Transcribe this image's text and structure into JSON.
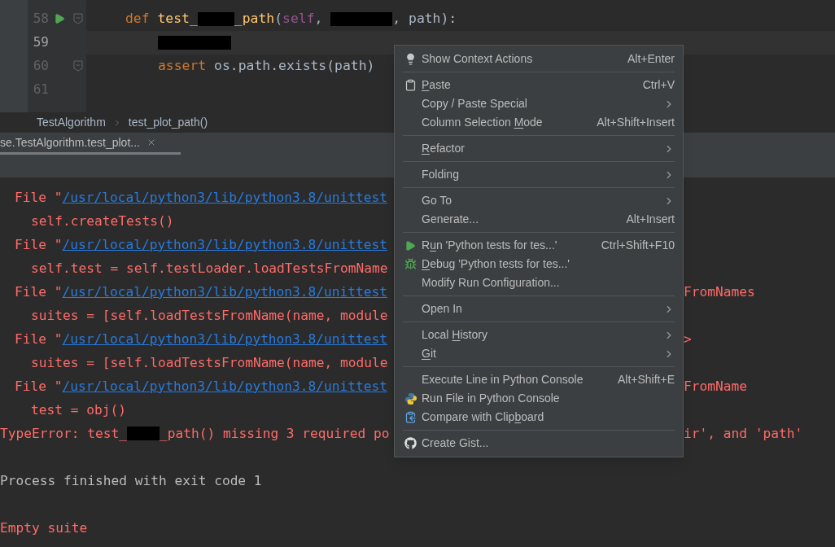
{
  "editor": {
    "lines": [
      {
        "number": "58",
        "current": false,
        "run_marker": true,
        "fold_marker": true,
        "segments": [
          {
            "kind": "keyword",
            "text": "def "
          },
          {
            "kind": "function",
            "text": "test_"
          },
          {
            "kind": "redacted"
          },
          {
            "kind": "function",
            "text": "_path"
          },
          {
            "kind": "plain",
            "text": "("
          },
          {
            "kind": "self",
            "text": "self"
          },
          {
            "kind": "plain",
            "text": ", "
          },
          {
            "kind": "redacted"
          },
          {
            "kind": "plain",
            "text": ", path):"
          }
        ],
        "children": [
          {
            "number": "59",
            "current": true,
            "run_marker": false,
            "fold_marker": false,
            "segments": [
              {
                "kind": "redacted"
              }
            ]
          },
          {
            "number": "60",
            "current": false,
            "run_marker": false,
            "fold_marker": true,
            "segments": [
              {
                "kind": "keyword",
                "text": "assert "
              },
              {
                "kind": "plain",
                "text": "os.path.exists(path)"
              }
            ]
          }
        ]
      },
      {
        "number": "61",
        "current": false,
        "run_marker": false,
        "fold_marker": false
      }
    ]
  },
  "breadcrumbs": [
    "TestAlgorithm",
    "test_plot_path()"
  ],
  "run_tab": {
    "label": "se.TestAlgorithm.test_plot...",
    "selected": true
  },
  "console": [
    {
      "kind": "file",
      "prefix": "File \"",
      "link": "/usr/local/python3/lib/python3.8/unittest",
      "children": [
        {
          "kind": "code",
          "text": "self.createTests()"
        }
      ]
    },
    {
      "kind": "file",
      "prefix": "File \"",
      "link": "/usr/local/python3/lib/python3.8/unittest",
      "children": [
        {
          "kind": "code",
          "text": "self.test = self.testLoader.loadTestsFromName"
        }
      ]
    },
    {
      "kind": "file",
      "prefix": "File \"",
      "link": "/usr/local/python3/lib/python3.8/unittest",
      "right": "FromNames",
      "children": [
        {
          "kind": "code",
          "text": "suites = [self.loadTestsFromName(name, module"
        }
      ]
    },
    {
      "kind": "file",
      "prefix": "File \"",
      "link": "/usr/local/python3/lib/python3.8/unittest",
      "right": ">",
      "children": [
        {
          "kind": "code",
          "text": "suites = [self.loadTestsFromName(name, module"
        }
      ]
    },
    {
      "kind": "file",
      "prefix": "File \"",
      "link": "/usr/local/python3/lib/python3.8/unittest",
      "right": "FromName",
      "children": [
        {
          "kind": "code",
          "text": "test = obj()"
        }
      ]
    },
    {
      "kind": "error",
      "segments": [
        {
          "kind": "plain",
          "text": "TypeError: test_"
        },
        {
          "kind": "redacted"
        },
        {
          "kind": "plain",
          "text": "_path() missing 3 required po"
        }
      ],
      "right": "ir', and 'path'"
    },
    {
      "kind": "blank"
    },
    {
      "kind": "info",
      "text": "Process finished with exit code 1"
    },
    {
      "kind": "blank"
    },
    {
      "kind": "error",
      "segments": [
        {
          "kind": "plain",
          "text": "Empty suite"
        }
      ]
    }
  ],
  "context_menu": {
    "groups": [
      [
        {
          "label": "Show Context Actions",
          "shortcut": "Alt+Enter",
          "submenu": false
        }
      ],
      [
        {
          "mnemonic": "P",
          "label_after": "aste",
          "shortcut": "Ctrl+V",
          "submenu": false
        },
        {
          "label": "Copy / Paste Special",
          "submenu": true
        },
        {
          "label": "Column Selection ",
          "mnemonic": "M",
          "label_after": "ode",
          "shortcut": "Alt+Shift+Insert",
          "submenu": false
        }
      ],
      [
        {
          "mnemonic": "R",
          "label_after": "efactor",
          "submenu": true
        }
      ],
      [
        {
          "label": "Folding",
          "submenu": true
        }
      ],
      [
        {
          "label": "Go To",
          "submenu": true
        },
        {
          "label": "Generate...",
          "shortcut": "Alt+Insert",
          "submenu": false
        }
      ],
      [
        {
          "label": "R",
          "mnemonic": "u",
          "label_after": "n 'Python tests for tes...'",
          "shortcut": "Ctrl+Shift+F10",
          "submenu": false
        },
        {
          "mnemonic": "D",
          "label_after": "ebug 'Python tests for tes...'",
          "submenu": false
        },
        {
          "label": "Modify Run Configuration...",
          "submenu": false
        }
      ],
      [
        {
          "label": "Open In",
          "submenu": true
        }
      ],
      [
        {
          "label": "Local ",
          "mnemonic": "H",
          "label_after": "istory",
          "submenu": true
        },
        {
          "mnemonic": "G",
          "label_after": "it",
          "submenu": true
        }
      ],
      [
        {
          "label": "Execute Line in Python Console",
          "shortcut": "Alt+Shift+E",
          "submenu": false
        },
        {
          "label": "Run File in Python Console",
          "submenu": false
        },
        {
          "label": "Compare with Clip",
          "mnemonic": "b",
          "label_after": "oard",
          "submenu": false
        }
      ],
      [
        {
          "label": "Create Gist...",
          "submenu": false
        }
      ]
    ]
  }
}
